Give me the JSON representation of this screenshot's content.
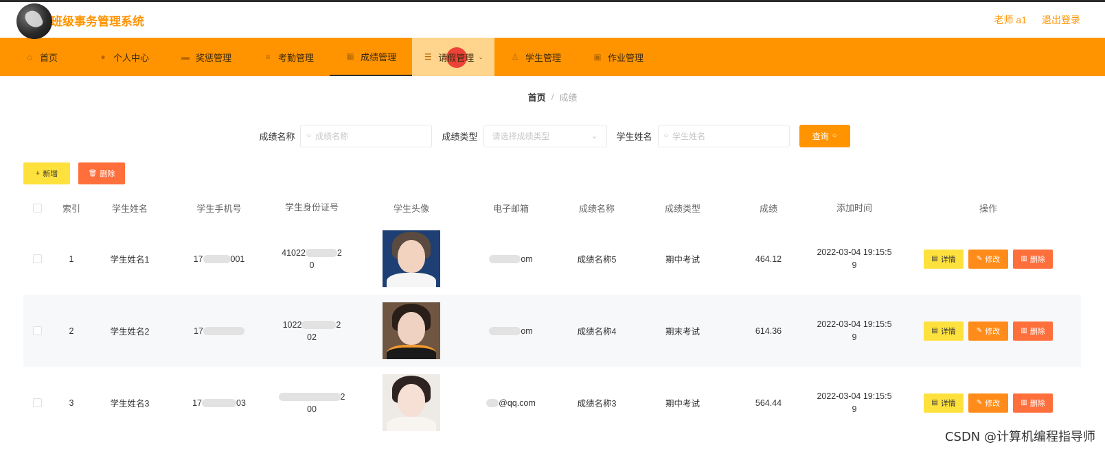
{
  "app": {
    "title": "班级事务管理系统",
    "user": "老师 a1",
    "logout": "退出登录"
  },
  "nav": [
    {
      "label": "首页",
      "icon": "home-icon"
    },
    {
      "label": "个人中心",
      "icon": "user-icon"
    },
    {
      "label": "奖惩管理",
      "icon": "award-icon"
    },
    {
      "label": "考勤管理",
      "icon": "attendance-icon"
    },
    {
      "label": "成绩管理",
      "icon": "grid-icon"
    },
    {
      "label": "请假管理",
      "icon": "list-icon"
    },
    {
      "label": "学生管理",
      "icon": "student-icon"
    },
    {
      "label": "作业管理",
      "icon": "homework-icon"
    }
  ],
  "breadcrumb": {
    "home": "首页",
    "separator": "/",
    "current": "成绩"
  },
  "search": {
    "grade_name_label": "成绩名称",
    "grade_name_placeholder": "成绩名称",
    "grade_type_label": "成绩类型",
    "grade_type_placeholder": "请选择成绩类型",
    "student_name_label": "学生姓名",
    "student_name_placeholder": "学生姓名",
    "query_label": "查询"
  },
  "actions": {
    "add_label": "新增",
    "delete_label": "删除"
  },
  "table": {
    "headers": [
      "索引",
      "学生姓名",
      "学生手机号",
      "学生身份证号",
      "学生头像",
      "电子邮箱",
      "成绩名称",
      "成绩类型",
      "成绩",
      "添加时间",
      "操作"
    ],
    "rows": [
      {
        "index": "1",
        "name": "学生姓名1",
        "phone_start": "17",
        "phone_end": "001",
        "id_line1_start": "41022",
        "id_line1_end": "2",
        "id_line2": "0",
        "email_end": "om",
        "grade_name": "成绩名称5",
        "grade_type": "期中考试",
        "score": "464.12",
        "time_line1": "2022-03-04 19:15:5",
        "time_line2": "9"
      },
      {
        "index": "2",
        "name": "学生姓名2",
        "phone_start": "17",
        "phone_end": "",
        "id_line1_start": "1022",
        "id_line1_end": "2",
        "id_line2": "02",
        "email_end": "om",
        "grade_name": "成绩名称4",
        "grade_type": "期末考试",
        "score": "614.36",
        "time_line1": "2022-03-04 19:15:5",
        "time_line2": "9"
      },
      {
        "index": "3",
        "name": "学生姓名3",
        "phone_start": "17",
        "phone_end": "03",
        "id_line1_start": "",
        "id_line1_end": "2",
        "id_line2": "00",
        "email_end": "@qq.com",
        "grade_name": "成绩名称3",
        "grade_type": "期中考试",
        "score": "564.44",
        "time_line1": "2022-03-04 19:15:5",
        "time_line2": "9"
      }
    ],
    "ops": {
      "detail": "详情",
      "edit": "修改",
      "delete": "删除"
    }
  },
  "watermark": "CSDN @计算机编程指导师",
  "colors": {
    "primary": "#ff9400",
    "yellow_button": "#ffe13d",
    "orange_button": "#ff8c1a",
    "red_button": "#ff6f3c"
  }
}
